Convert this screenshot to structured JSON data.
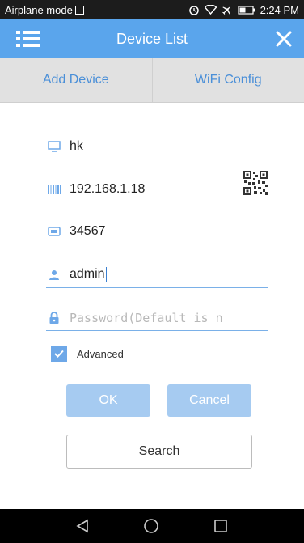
{
  "status_bar": {
    "mode": "Airplane mode",
    "time": "2:24 PM"
  },
  "app_bar": {
    "title": "Device List"
  },
  "tabs": [
    {
      "label": "Add Device"
    },
    {
      "label": "WiFi Config"
    }
  ],
  "form": {
    "device_name": "hk",
    "ip_address": "192.168.1.18",
    "port": "34567",
    "username": "admin",
    "password_placeholder": "Password(Default is n"
  },
  "advanced": {
    "label": "Advanced",
    "checked": true
  },
  "buttons": {
    "ok": "OK",
    "cancel": "Cancel",
    "search": "Search"
  },
  "colors": {
    "accent": "#5aa5ec",
    "button_fill": "#a6cbf1",
    "tab_text": "#4a8fd8"
  }
}
